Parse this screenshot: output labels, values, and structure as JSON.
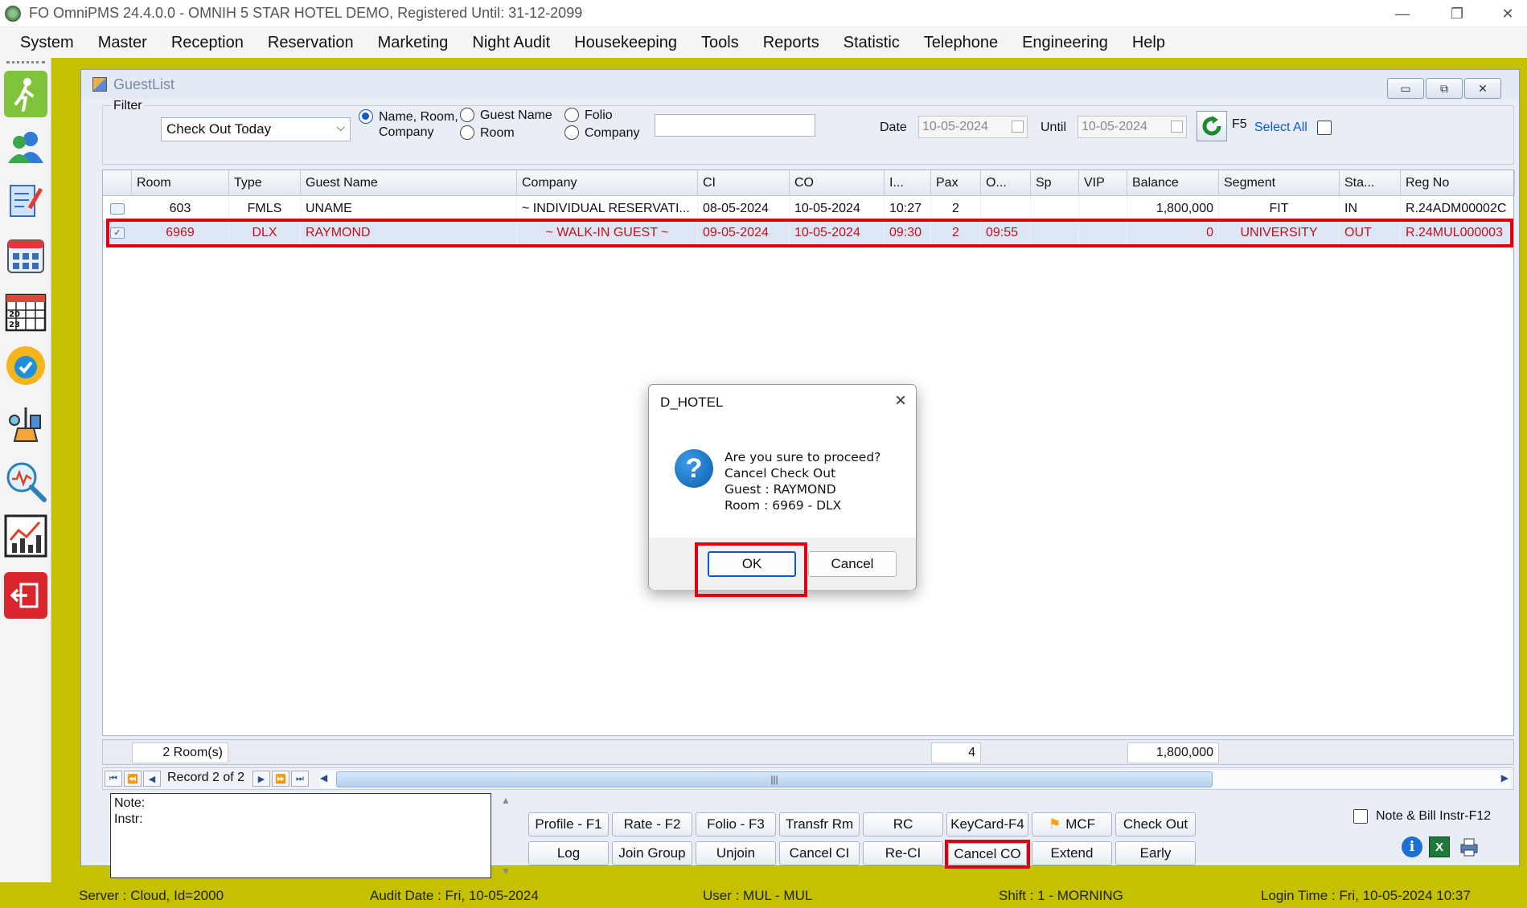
{
  "window": {
    "title": "FO OmniPMS 24.4.0.0 - OMNIH 5 STAR HOTEL DEMO, Registered Until: 31-12-2099",
    "minimize": "—",
    "maximize": "❐",
    "close": "✕"
  },
  "menu": [
    "System",
    "Master",
    "Reception",
    "Reservation",
    "Marketing",
    "Night Audit",
    "Housekeeping",
    "Tools",
    "Reports",
    "Statistic",
    "Telephone",
    "Engineering",
    "Help"
  ],
  "left_toolbar_icons": [
    "walk-in-icon",
    "guests-icon",
    "checklist-icon",
    "room-grid-icon",
    "calendar-icon",
    "available-badge-icon",
    "housekeeping-icon",
    "search-analytics-icon",
    "statistics-chart-icon",
    "exit-icon"
  ],
  "guestlist": {
    "title": "GuestList",
    "filter": {
      "legend": "Filter",
      "combo_value": "Check Out Today",
      "radios": {
        "name_room_company_1": "Name, Room,",
        "name_room_company_2": "Company",
        "guest_name": "Guest Name",
        "room": "Room",
        "folio": "Folio",
        "company": "Company"
      },
      "search_value": "",
      "date_label": "Date",
      "date_value": "10-05-2024",
      "until_label": "Until",
      "until_value": "10-05-2024",
      "f5_label": "F5",
      "select_all": "Select All"
    },
    "columns": [
      "Room",
      "Type",
      "Guest Name",
      "Company",
      "CI",
      "CO",
      "I...",
      "Pax",
      "O...",
      "Sp",
      "VIP",
      "Balance",
      "Segment",
      "Sta...",
      "Reg No"
    ],
    "rows": [
      {
        "room": "603",
        "type": "FMLS",
        "guest": "UNAME",
        "company": "~ INDIVIDUAL RESERVATI...",
        "ci": "08-05-2024",
        "co": "10-05-2024",
        "in": "10:27",
        "pax": "2",
        "out": "",
        "sp": "",
        "vip": "",
        "balance": "1,800,000",
        "segment": "FIT",
        "status": "IN",
        "regno": "R.24ADM00002C"
      },
      {
        "room": "6969",
        "type": "DLX",
        "guest": "RAYMOND",
        "company": "~ WALK-IN GUEST ~",
        "ci": "09-05-2024",
        "co": "10-05-2024",
        "in": "09:30",
        "pax": "2",
        "out": "09:55",
        "sp": "",
        "vip": "",
        "balance": "0",
        "segment": "UNIVERSITY",
        "status": "OUT",
        "regno": "R.24MUL000003"
      }
    ],
    "footer": {
      "rooms": "2 Room(s)",
      "pax_total": "4",
      "balance_total": "1,800,000"
    },
    "nav": {
      "record": "Record 2 of 2"
    },
    "notes": {
      "note": "Note:",
      "instr": "Instr:"
    },
    "buttons_row1": [
      "Profile - F1",
      "Rate - F2",
      "Folio - F3",
      "Transfr Rm",
      "RC",
      "KeyCard-F4",
      "MCF",
      "Check Out"
    ],
    "buttons_row2": [
      "Log",
      "Join Group",
      "Unjoin",
      "Cancel CI",
      "Re-CI",
      "Cancel CO",
      "Extend",
      "Early"
    ],
    "note_bill_label": "Note & Bill Instr-F12"
  },
  "dialog": {
    "title": "D_HOTEL",
    "line1": "Are you sure to proceed?",
    "line2": "Cancel Check Out",
    "line3": "Guest : RAYMOND",
    "line4": "Room : 6969 - DLX",
    "ok": "OK",
    "cancel": "Cancel"
  },
  "status": {
    "server": "Server : Cloud, Id=2000",
    "audit": "Audit Date : Fri, 10-05-2024",
    "user": "User : MUL - MUL",
    "shift": "Shift : 1 - MORNING",
    "login": "Login Time : Fri, 10-05-2024 10:37"
  },
  "colors": {
    "workspace": "#c5c100",
    "highlight_red": "#e00010",
    "selected_text": "#c0101c",
    "link_blue": "#0a58c9"
  }
}
